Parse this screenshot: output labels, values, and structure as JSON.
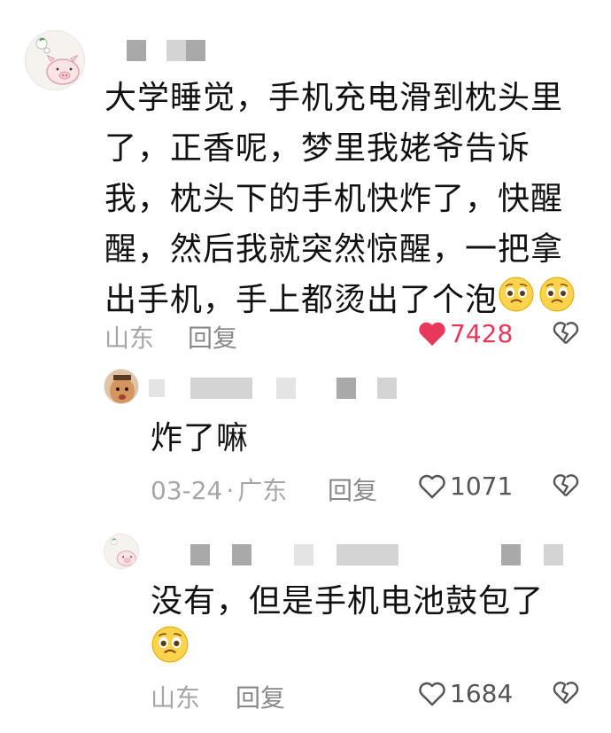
{
  "comments": [
    {
      "id": "main",
      "text_lines": [
        "大学睡觉，手机充电滑到枕头里",
        "了，正香呢，梦里我姥爷告诉",
        "我，枕头下的手机快炸了，快醒",
        "醒，然后我就突然惊醒，一把拿",
        "出手机，手上都烫出了个泡"
      ],
      "location": "山东",
      "reply_label": "回复",
      "likes": "7428",
      "liked": true,
      "emoji_icons": [
        "pleading-face-icon",
        "pleading-face-icon"
      ]
    },
    {
      "id": "reply1",
      "text_lines": [
        "炸了嘛"
      ],
      "date": "03-24",
      "separator": "·",
      "location": "广东",
      "reply_label": "回复",
      "likes": "1071",
      "liked": false
    },
    {
      "id": "reply2",
      "text_lines": [
        "没有，但是手机电池鼓包了"
      ],
      "location": "山东",
      "reply_label": "回复",
      "likes": "1684",
      "liked": false,
      "emoji_icons": [
        "pleading-face-icon"
      ]
    }
  ],
  "colors": {
    "liked_heart": "#e8385a",
    "meta_text": "#a6a6a6",
    "body_text": "#111111"
  },
  "icons": [
    "heart-icon",
    "broken-heart-icon",
    "pleading-face-icon",
    "avatar-pig"
  ]
}
